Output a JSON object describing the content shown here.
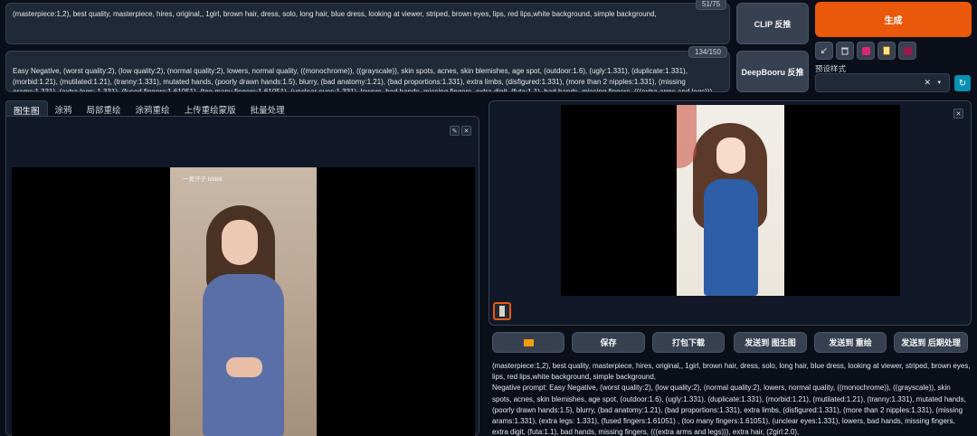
{
  "prompt": {
    "text": "(masterpiece:1,2), best quality, masterpiece, hires, original,, 1girl, brown hair, dress, solo, long hair, blue dress, looking at viewer, striped, brown eyes, lips, red lips,white background, simple background,",
    "counter": "51/75"
  },
  "negative_prompt": {
    "text": "Easy Negative, (worst quality:2), (low quality:2), (normal quality:2), lowers, normal quality, ((monochrome)), ((grayscale)), skin spots, acnes, skin blemishes, age spot, (outdoor:1.6), (ugly:1.331), (duplicate:1.331), (morbid:1.21), (mutilated:1.21), (tranny:1.331), mutated hands, (poorly drawn hands:1.5), blurry, (bad anatomy:1.21), (bad proportions:1.331), extra limbs, (disfigured:1.331), (more than 2 nipples:1.331), (missing arams:1.331), (extra legs: 1.331),  (fused fingers:1.61051) ,(too many fingers:1.61051), (unclear eyes:1.331), lowers, bad hands, missing fingers, extra digit, (futa:1.1), bad hands, missing fingers, (((extra arms and legs))), extra hair, (2girl:2.0),",
    "counter": "134/150"
  },
  "buttons": {
    "clip": "CLIP 反推",
    "deepbooru": "DeepBooru 反推",
    "generate": "生成",
    "preset_label": "预设样式",
    "save": "保存",
    "zip": "打包下载",
    "send_img2img": "发送到 图生图",
    "send_inpaint": "发送到 重绘",
    "send_extras": "发送到 后期处理"
  },
  "tabs": [
    "图生图",
    "涂鸦",
    "局部重绘",
    "涂鸦重绘",
    "上传重绘蒙版",
    "批量处理"
  ],
  "input_image": {
    "watermark": "一黄汗子 bilibili"
  },
  "output_info": {
    "line1": "(masterpiece:1,2), best quality, masterpiece, hires, original,, 1girl, brown hair, dress, solo, long hair, blue dress, looking at viewer, striped, brown eyes, lips, red lips,white background, simple background,",
    "line2": "Negative prompt: Easy Negative, (worst quality:2), (low quality:2), (normal quality:2), lowers, normal quality, ((monochrome)), ((grayscale)), skin spots, acnes, skin blemishes, age spot, (outdoor:1.6), (ugly:1.331), (duplicate:1.331), (morbid:1.21), (mutilated:1.21), (tranny:1.331), mutated hands, (poorly drawn hands:1.5), blurry, (bad anatomy:1.21), (bad proportions:1.331), extra limbs, (disfigured:1.331), (more than 2 nipples:1.331), (missing arams:1.331), (extra legs: 1.331),  (fused fingers:1.61051) , (too many fingers:1.61051), (unclear eyes:1.331), lowers, bad hands, missing fingers, extra digit, (futa:1.1), bad hands, missing fingers, (((extra arms and legs))), extra hair, (2girl:2.0),"
  },
  "colors": {
    "accent": "#ea580c",
    "background": "#0b0f19",
    "panel": "#1f2937"
  },
  "icons": [
    "paint-icon",
    "trash-icon",
    "style-icon",
    "clipboard-icon",
    "save-style-icon",
    "refresh-icon",
    "folder-icon",
    "pencil-icon",
    "close-icon"
  ]
}
